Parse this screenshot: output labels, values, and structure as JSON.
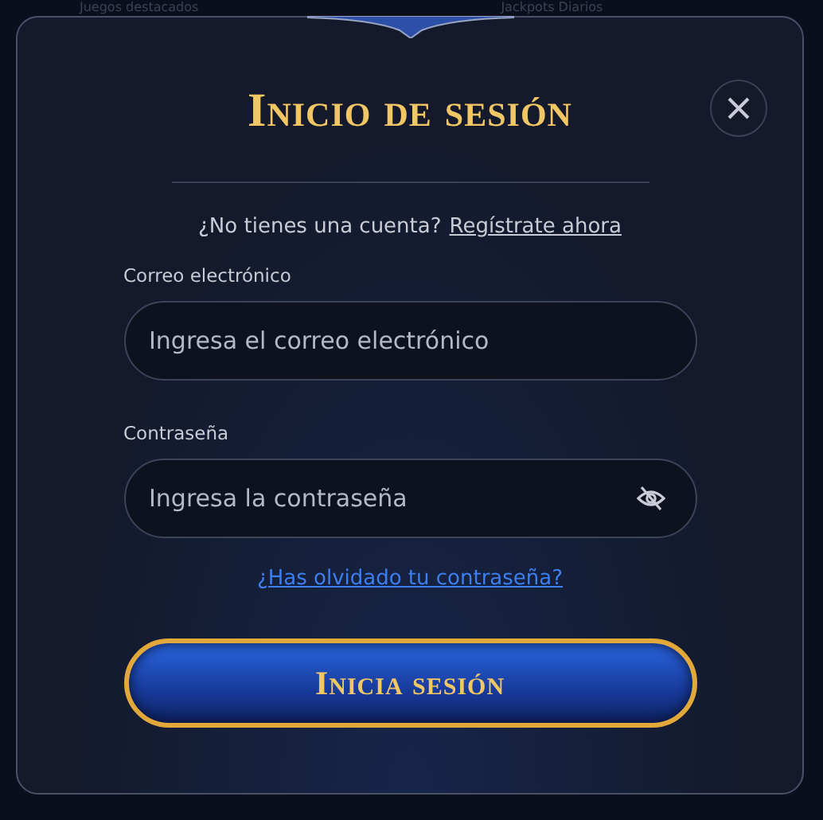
{
  "background": {
    "headings": [
      "Juegos destacados",
      "Jackpots Diarios"
    ]
  },
  "dialog": {
    "title": "Inicio de sesión",
    "signup": {
      "prompt": "¿No tienes una cuenta?",
      "link": "Regístrate ahora"
    },
    "fields": [
      {
        "label": "Correo electrónico",
        "placeholder": "Ingresa el correo electrónico",
        "kind": "email"
      },
      {
        "label": "Contraseña",
        "placeholder": "Ingresa la contraseña",
        "kind": "password"
      }
    ],
    "forgot_link": "¿Has olvidado tu contraseña?",
    "submit": "Inicia sesión"
  }
}
